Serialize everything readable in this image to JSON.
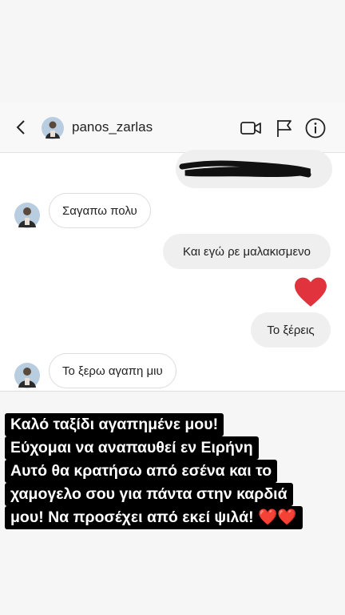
{
  "header": {
    "username": "panos_zarlas",
    "icons": [
      "back-chevron-icon",
      "avatar",
      "video-camera-icon",
      "flag-icon",
      "info-icon"
    ]
  },
  "chat": {
    "messages": [
      {
        "side": "out",
        "text": "",
        "note": "scribbled-out"
      },
      {
        "side": "in",
        "text": "Σαγαπω πολυ"
      },
      {
        "side": "out",
        "text": "Και εγώ ρε μαλακισμενο"
      },
      {
        "side": "out",
        "text": "heart"
      },
      {
        "side": "out",
        "text": "Το ξέρεις"
      },
      {
        "side": "in",
        "text": "Το ξερω αγαπη μιυ"
      }
    ]
  },
  "caption": {
    "lines": [
      "Καλό ταξίδι αγαπημένε μου!",
      "Εύχομαι να αναπαυθεί εν Ειρήνη",
      "Αυτό θα κρατήσω από εσένα και το",
      "χαμογελο σου για πάντα στην καρδιά",
      "μου! Να προσέχει από εκεί ψιλά!"
    ],
    "hearts": "❤️❤️"
  },
  "colors": {
    "heart": "#e0333d",
    "caption_bg": "#000000",
    "outgoing_bubble": "#efefef"
  }
}
